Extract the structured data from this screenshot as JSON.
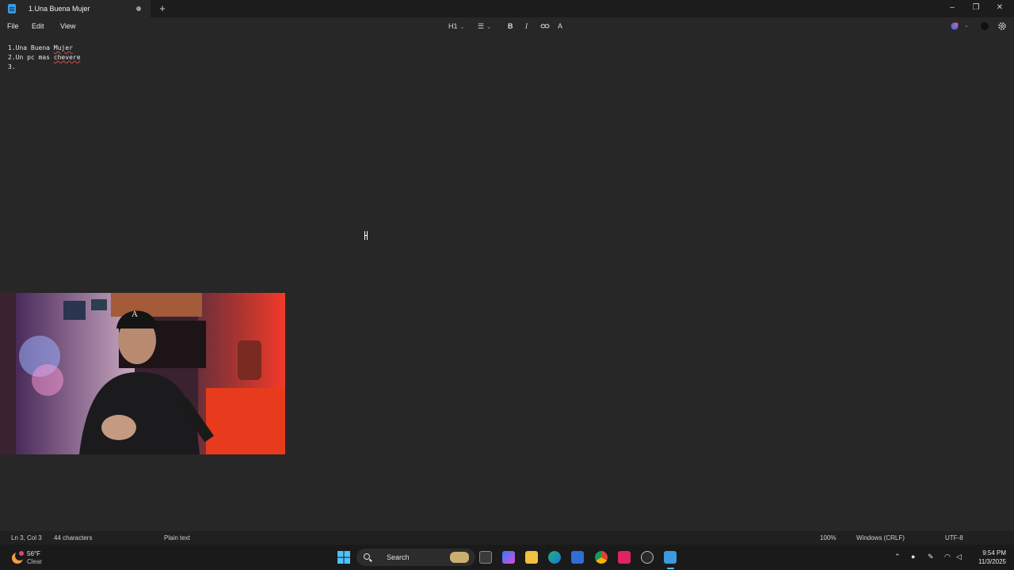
{
  "window": {
    "tab_title": "1.Una Buena Mujer",
    "new_tab": "+",
    "minimize": "–",
    "maximize": "❐",
    "close": "✕"
  },
  "menu": {
    "file": "File",
    "edit": "Edit",
    "view": "View"
  },
  "toolbar": {
    "heading": "H1",
    "list": "☰",
    "bold": "B",
    "italic": "I",
    "link": "⊘",
    "clear_format": "A"
  },
  "document": {
    "line1": "1.Una Buena Mujer",
    "line1_prefix": "1.Una Buena ",
    "line1_misspelled": "Mujer",
    "line2_prefix": "2.Un pc mas ",
    "line2_misspelled": "chevere",
    "line3": "3."
  },
  "statusbar": {
    "position": "Ln 3, Col 3",
    "characters": "44 characters",
    "format": "Plain text",
    "zoom": "100%",
    "line_ending": "Windows (CRLF)",
    "encoding": "UTF-8"
  },
  "taskbar": {
    "weather_temp": "56°F",
    "weather_desc": "Clear",
    "search_label": "Search",
    "time": "9:54 PM",
    "date": "11/3/2025"
  },
  "colors": {
    "background": "#272727",
    "titlebar": "#1c1c1c",
    "accent": "#3a9be0",
    "spell_error": "#e04848"
  }
}
